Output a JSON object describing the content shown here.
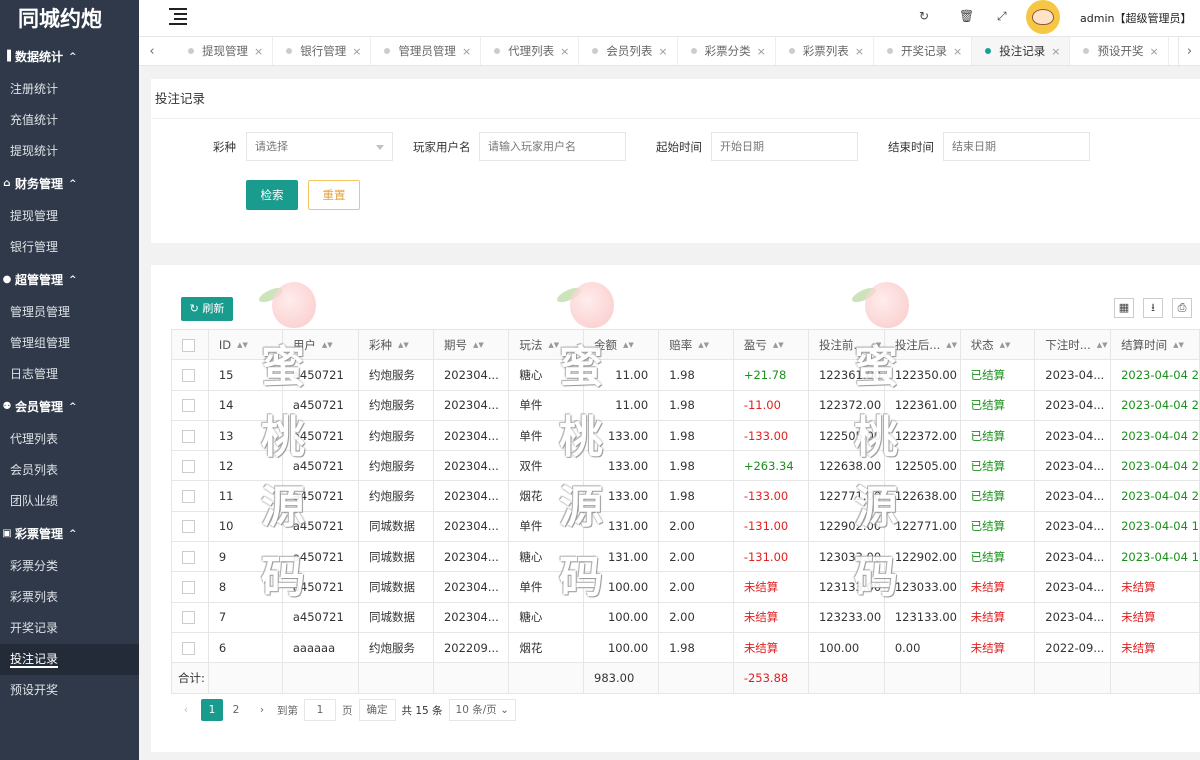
{
  "app": {
    "title": "同城约炮"
  },
  "sidebar": {
    "groups": [
      {
        "icon": "bar-chart-icon",
        "label": "数据统计",
        "items": [
          "注册统计",
          "充值统计",
          "提现统计"
        ]
      },
      {
        "icon": "bank-icon",
        "label": "财务管理",
        "items": [
          "提现管理",
          "银行管理"
        ]
      },
      {
        "icon": "user-icon",
        "label": "超管管理",
        "items": [
          "管理员管理",
          "管理组管理",
          "日志管理"
        ]
      },
      {
        "icon": "users-icon",
        "label": "会员管理",
        "items": [
          "代理列表",
          "会员列表",
          "团队业绩"
        ]
      },
      {
        "icon": "ticket-icon",
        "label": "彩票管理",
        "items": [
          "彩票分类",
          "彩票列表",
          "开奖记录",
          "投注记录",
          "预设开奖"
        ]
      }
    ],
    "active_item": "投注记录"
  },
  "header": {
    "user": "admin【超级管理员】"
  },
  "tabs": [
    "提现管理",
    "银行管理",
    "管理员管理",
    "代理列表",
    "会员列表",
    "彩票分类",
    "彩票列表",
    "开奖记录",
    "投注记录",
    "预设开奖"
  ],
  "active_tab": "投注记录",
  "filter": {
    "title": "投注记录",
    "lottery_label": "彩种",
    "lottery_value": "请选择",
    "username_label": "玩家用户名",
    "username_placeholder": "请输入玩家用户名",
    "start_label": "起始时间",
    "start_placeholder": "开始日期",
    "end_label": "结束时间",
    "end_placeholder": "结束日期",
    "search_label": "检索",
    "reset_label": "重置"
  },
  "table": {
    "refresh_label": "刷新",
    "columns": [
      "ID",
      "用户",
      "彩种",
      "期号",
      "玩法",
      "金额",
      "赔率",
      "盈亏",
      "投注前...",
      "投注后...",
      "状态",
      "下注时...",
      "结算时间"
    ],
    "rows": [
      [
        "15",
        "a450721",
        "约炮服务",
        "202304...",
        "糖心",
        "11.00",
        "1.98",
        "+21.78",
        "122361.00",
        "122350.00",
        "已结算",
        "2023-04...",
        "2023-04-04 2"
      ],
      [
        "14",
        "a450721",
        "约炮服务",
        "202304...",
        "单件",
        "11.00",
        "1.98",
        "-11.00",
        "122372.00",
        "122361.00",
        "已结算",
        "2023-04...",
        "2023-04-04 2"
      ],
      [
        "13",
        "a450721",
        "约炮服务",
        "202304...",
        "单件",
        "133.00",
        "1.98",
        "-133.00",
        "122505.00",
        "122372.00",
        "已结算",
        "2023-04...",
        "2023-04-04 2"
      ],
      [
        "12",
        "a450721",
        "约炮服务",
        "202304...",
        "双件",
        "133.00",
        "1.98",
        "+263.34",
        "122638.00",
        "122505.00",
        "已结算",
        "2023-04...",
        "2023-04-04 2"
      ],
      [
        "11",
        "a450721",
        "约炮服务",
        "202304...",
        "烟花",
        "133.00",
        "1.98",
        "-133.00",
        "122771.00",
        "122638.00",
        "已结算",
        "2023-04...",
        "2023-04-04 2"
      ],
      [
        "10",
        "a450721",
        "同城数据",
        "202304...",
        "单件",
        "131.00",
        "2.00",
        "-131.00",
        "122902.00",
        "122771.00",
        "已结算",
        "2023-04...",
        "2023-04-04 1"
      ],
      [
        "9",
        "a450721",
        "同城数据",
        "202304...",
        "糖心",
        "131.00",
        "2.00",
        "-131.00",
        "123033.00",
        "122902.00",
        "已结算",
        "2023-04...",
        "2023-04-04 1"
      ],
      [
        "8",
        "a450721",
        "同城数据",
        "202304...",
        "单件",
        "100.00",
        "2.00",
        "未结算",
        "123133.00",
        "123033.00",
        "未结算",
        "2023-04...",
        "未结算"
      ],
      [
        "7",
        "a450721",
        "同城数据",
        "202304...",
        "糖心",
        "100.00",
        "2.00",
        "未结算",
        "123233.00",
        "123133.00",
        "未结算",
        "2023-04...",
        "未结算"
      ],
      [
        "6",
        "aaaaaa",
        "约炮服务",
        "202209...",
        "烟花",
        "100.00",
        "1.98",
        "未结算",
        "100.00",
        "0.00",
        "未结算",
        "2022-09...",
        "未结算"
      ]
    ],
    "sum_label": "合计:",
    "sum_amount": "983.00",
    "sum_profit": "-253.88"
  },
  "pagination": {
    "pages": [
      "1",
      "2"
    ],
    "current": "1",
    "goto_label": "到第",
    "goto_value": "1",
    "page_unit": "页",
    "confirm_label": "确定",
    "total": "共 15 条",
    "page_size": "10 条/页"
  },
  "watermark": {
    "chars": [
      "蜜",
      "桃",
      "源",
      "码"
    ]
  },
  "colors": {
    "primary": "#199c8e",
    "sidebar": "#2f3949",
    "positive": "#1b8f1b",
    "negative": "#e02020",
    "reset_border": "#f3c564"
  }
}
